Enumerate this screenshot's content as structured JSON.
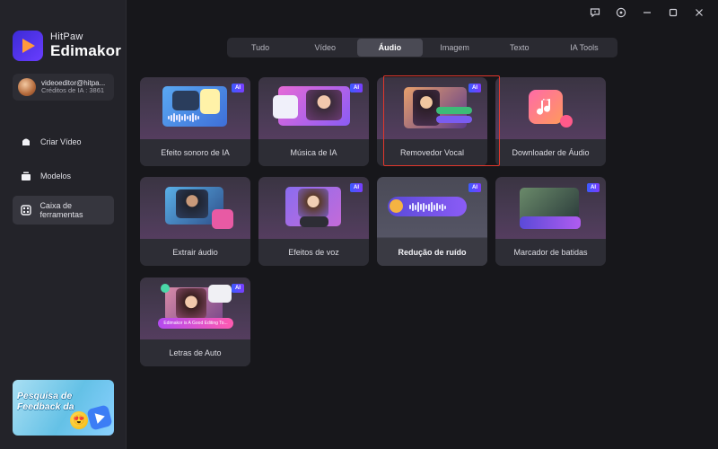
{
  "app": {
    "brand_line1": "HitPaw",
    "brand_line2": "Edimakor"
  },
  "account": {
    "email": "videoeditor@hitpa...",
    "credits": "Créditos de IA : 3861"
  },
  "nav": [
    {
      "label": "Criar Vídeo",
      "icon": "create-video-icon"
    },
    {
      "label": "Modelos",
      "icon": "templates-icon"
    },
    {
      "label": "Caixa de ferramentas",
      "icon": "toolbox-icon",
      "active": true
    }
  ],
  "feedback": {
    "text": "Pesquisa de Feedback da",
    "emoji": "😍"
  },
  "window": {
    "controls": [
      "feedback-icon",
      "settings-icon",
      "minimize-icon",
      "maximize-icon",
      "close-icon"
    ]
  },
  "tabs": [
    {
      "label": "Tudo"
    },
    {
      "label": "Vídeo"
    },
    {
      "label": "Áudio",
      "active": true
    },
    {
      "label": "Imagem"
    },
    {
      "label": "Texto"
    },
    {
      "label": "IA Tools"
    }
  ],
  "cards": [
    {
      "label": "Efeito sonoro de IA",
      "ai": true
    },
    {
      "label": "Música de IA",
      "ai": true
    },
    {
      "label": "Removedor Vocal",
      "ai": true,
      "highlighted": true
    },
    {
      "label": "Downloader de Áudio",
      "ai": false
    },
    {
      "label": "Extrair áudio",
      "ai": false
    },
    {
      "label": "Efeitos de voz",
      "ai": true
    },
    {
      "label": "Redução de ruído",
      "ai": true
    },
    {
      "label": "Marcador de batidas",
      "ai": true
    },
    {
      "label": "Letras de Auto",
      "ai": true,
      "lyric_caption": "Edimakor is A Good Editing To..."
    }
  ],
  "badge_text": "AI",
  "colors": {
    "accent": "#4a4a54",
    "highlight": "#e0372c",
    "ai_badge": "#5b4dff"
  }
}
